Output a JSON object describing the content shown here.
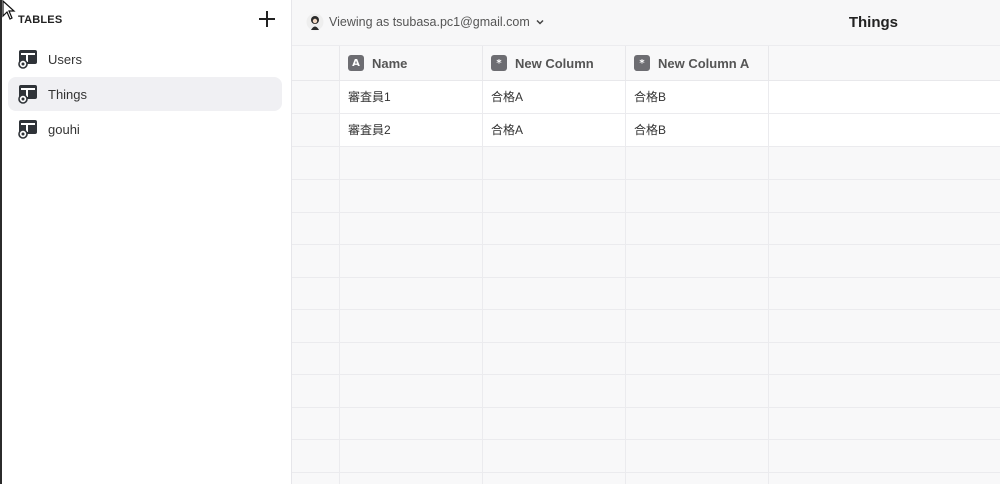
{
  "sidebar": {
    "header": "TABLES",
    "tables": [
      {
        "label": "Users"
      },
      {
        "label": "Things"
      },
      {
        "label": "gouhi"
      }
    ],
    "active_index": 1
  },
  "topbar": {
    "viewing_text": "Viewing as tsubasa.pc1@gmail.com",
    "title": "Things"
  },
  "grid": {
    "columns": [
      {
        "label": "Name",
        "type_icon": "A"
      },
      {
        "label": "New Column",
        "type_icon": "*"
      },
      {
        "label": "New Column A",
        "type_icon": "*"
      }
    ],
    "rows": [
      [
        "審査員1",
        "合格A",
        "合格B"
      ],
      [
        "審査員2",
        "合格A",
        "合格B"
      ]
    ]
  },
  "icons": {
    "add": "plus-icon",
    "table": "table-icon",
    "avatar": "user-avatar-icon",
    "chevron": "chevron-down-icon",
    "cursor": "mouse-pointer-icon"
  }
}
